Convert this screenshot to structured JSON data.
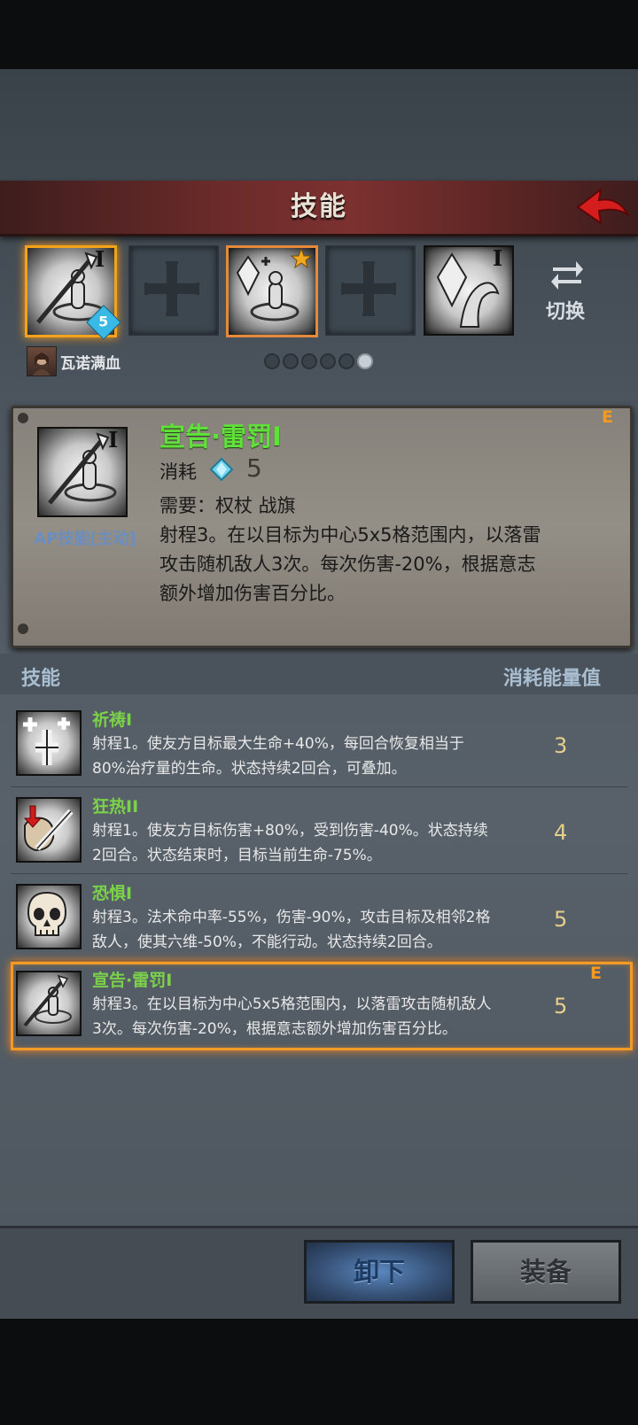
{
  "header": {
    "title": "技能"
  },
  "slots": [
    {
      "roman": "I",
      "badge": "5"
    },
    {},
    {},
    {},
    {
      "roman": "I"
    }
  ],
  "swap": {
    "label": "切换"
  },
  "character": {
    "name": "瓦诺满血"
  },
  "pager": {
    "total": 6,
    "active": 6
  },
  "detail": {
    "roman": "I",
    "type": "AP技能[主动]",
    "title": "宣告·雷罚I",
    "grade": "E",
    "cost_label": "消耗",
    "cost_value": "5",
    "requirement": "需要：权杖 战旗",
    "description_lines": [
      "射程3。在以目标为中心5x5格范围内，以落雷",
      "攻击随机敌人3次。每次伤害-20%，根据意志",
      "额外增加伤害百分比。"
    ]
  },
  "list": {
    "header_left": "技能",
    "header_right": "消耗能量值",
    "rows": [
      {
        "name": "祈祷I",
        "lines": [
          "射程1。使友方目标最大生命+40%，每回合恢复相当于",
          "80%治疗量的生命。状态持续2回合，可叠加。"
        ],
        "cost": "3",
        "icon": "heal-cross-icon"
      },
      {
        "name": "狂热II",
        "lines": [
          "射程1。使友方目标伤害+80%，受到伤害-40%。状态持续",
          "2回合。状态结束时，目标当前生命-75%。"
        ],
        "cost": "4",
        "icon": "frenzy-sword-icon"
      },
      {
        "name": "恐惧I",
        "lines": [
          "射程3。法术命中率-55%，伤害-90%，攻击目标及相邻2格",
          "敌人，使其六维-50%，不能行动。状态持续2回合。"
        ],
        "cost": "5",
        "icon": "skull-icon"
      },
      {
        "name": "宣告·雷罚I",
        "lines": [
          "射程3。在以目标为中心5x5格范围内，以落雷攻击随机敌人",
          "3次。每次伤害-20%，根据意志额外增加伤害百分比。"
        ],
        "cost": "5",
        "icon": "thunder-staff-icon",
        "grade": "E"
      }
    ]
  },
  "buttons": {
    "unequip": "卸下",
    "equip": "装备"
  },
  "colors": {
    "accent_orange": "#f19a25",
    "skill_name_green": "#7bd24a",
    "header_red": "#7c3130"
  }
}
